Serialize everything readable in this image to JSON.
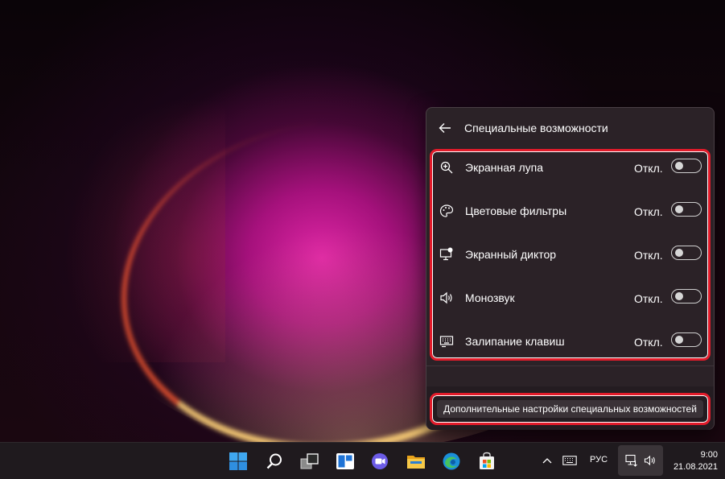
{
  "panel": {
    "title": "Специальные возможности",
    "items": [
      {
        "icon": "magnifier-icon",
        "label": "Экранная лупа",
        "state": "Откл.",
        "on": false
      },
      {
        "icon": "color-filters-icon",
        "label": "Цветовые фильтры",
        "state": "Откл.",
        "on": false
      },
      {
        "icon": "narrator-icon",
        "label": "Экранный диктор",
        "state": "Откл.",
        "on": false
      },
      {
        "icon": "mono-audio-icon",
        "label": "Монозвук",
        "state": "Откл.",
        "on": false
      },
      {
        "icon": "sticky-keys-icon",
        "label": "Залипание клавиш",
        "state": "Откл.",
        "on": false
      }
    ],
    "more_settings": "Дополнительные настройки специальных возможностей"
  },
  "taskbar": {
    "apps": [
      "windows-start-icon",
      "search-icon",
      "task-view-icon",
      "widgets-icon",
      "teams-chat-icon",
      "file-explorer-icon",
      "edge-icon",
      "store-icon"
    ],
    "language": "РУС",
    "time": "9:00",
    "date": "21.08.2021"
  },
  "colors": {
    "highlight": "#e21b2a",
    "panel_bg": "#2b2227"
  }
}
